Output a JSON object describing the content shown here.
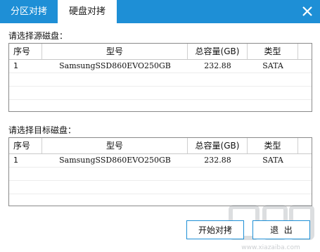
{
  "tabs": [
    {
      "label": "分区对拷",
      "active": false
    },
    {
      "label": "硬盘对拷",
      "active": true
    }
  ],
  "close_icon": "close-icon",
  "source_label": "请选择源磁盘：",
  "target_label": "请选择目标磁盘：",
  "columns": [
    "序号",
    "型号",
    "总容量(GB)",
    "类型"
  ],
  "source_rows": [
    {
      "index": "1",
      "model": "SamsungSSD860EVO250GB",
      "capacity": "232.88",
      "type": "SATA"
    }
  ],
  "target_rows": [
    {
      "index": "1",
      "model": "SamsungSSD860EVO250GB",
      "capacity": "232.88",
      "type": "SATA"
    }
  ],
  "buttons": {
    "start": "开始对拷",
    "exit": "退  出"
  },
  "watermark": "下载吧 www.xiazaiba.com",
  "colors": {
    "accent": "#1e8fd6"
  }
}
